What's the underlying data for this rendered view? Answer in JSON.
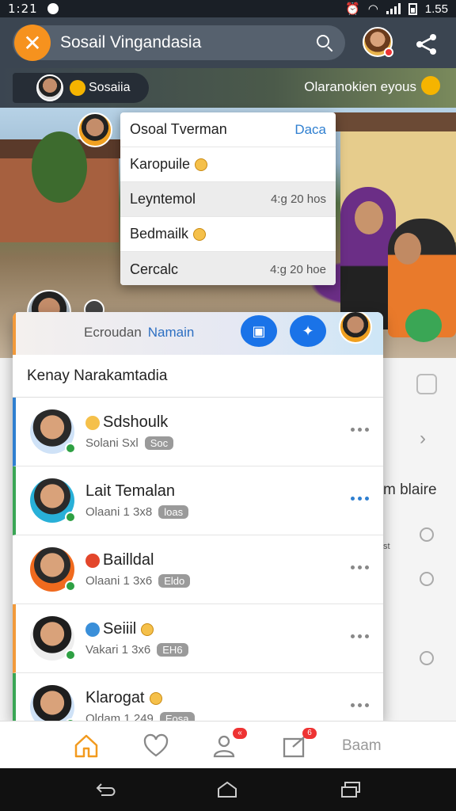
{
  "status_bar": {
    "time": "1:21",
    "right_time": "1.55"
  },
  "header": {
    "title": "Sosail Vingandasia",
    "close_symbol": "✕"
  },
  "substrip": {
    "chip_label": "Sosaiia",
    "right_text": "Olaranokien eyous"
  },
  "dropdown": {
    "items": [
      {
        "label": "Osoal Tverman",
        "meta": "Daca"
      },
      {
        "label": "Karopuile",
        "meta": ""
      },
      {
        "label": "Leyntemol",
        "meta": "4:g 20 hos"
      },
      {
        "label": "Bedmailk",
        "meta": ""
      },
      {
        "label": "Cercalc",
        "meta": "4:g 20 hoe"
      }
    ]
  },
  "panel": {
    "head_label": "Ecroudan",
    "head_link": "Namain",
    "subhead": "Kenay Narakamtadia",
    "contacts": [
      {
        "name": "Sdshoulk",
        "sub": "Solani Sxl",
        "tag": "Soc",
        "accent": "#2f7fd0"
      },
      {
        "name": "Lait Temalan",
        "sub": "Olaani 1 3x8",
        "tag": "loas",
        "accent": "#3aa655"
      },
      {
        "name": "Bailldal",
        "sub": "Olaani 1 3x6",
        "tag": "Eldo",
        "accent": "#ffffff"
      },
      {
        "name": "Seiiil",
        "sub": "Vakari 1 3x6",
        "tag": "EH6",
        "accent": "#f29a3b"
      },
      {
        "name": "Klarogat",
        "sub": "Oldam 1 249",
        "tag": "Eosa",
        "accent": "#3aa655"
      }
    ]
  },
  "behind": {
    "text": "m blaire",
    "small": "st"
  },
  "bottom_nav": {
    "last_label": "Baam",
    "badge1": "«",
    "badge2": "6"
  }
}
